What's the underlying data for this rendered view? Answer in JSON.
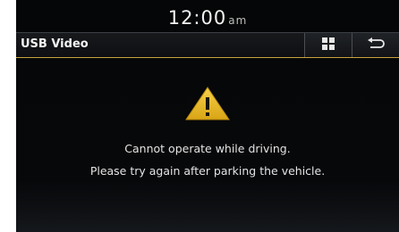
{
  "status_bar": {
    "time": "12:00",
    "ampm": "am"
  },
  "header": {
    "title": "USB Video",
    "menu_icon": "grid-menu-icon",
    "back_icon": "back-arrow-icon"
  },
  "alert": {
    "icon": "warning-triangle-icon",
    "line1": "Cannot operate while driving.",
    "line2": "Please try again after parking the vehicle."
  },
  "colors": {
    "accent": "#c7a43e",
    "warning": "#e6b81c"
  }
}
